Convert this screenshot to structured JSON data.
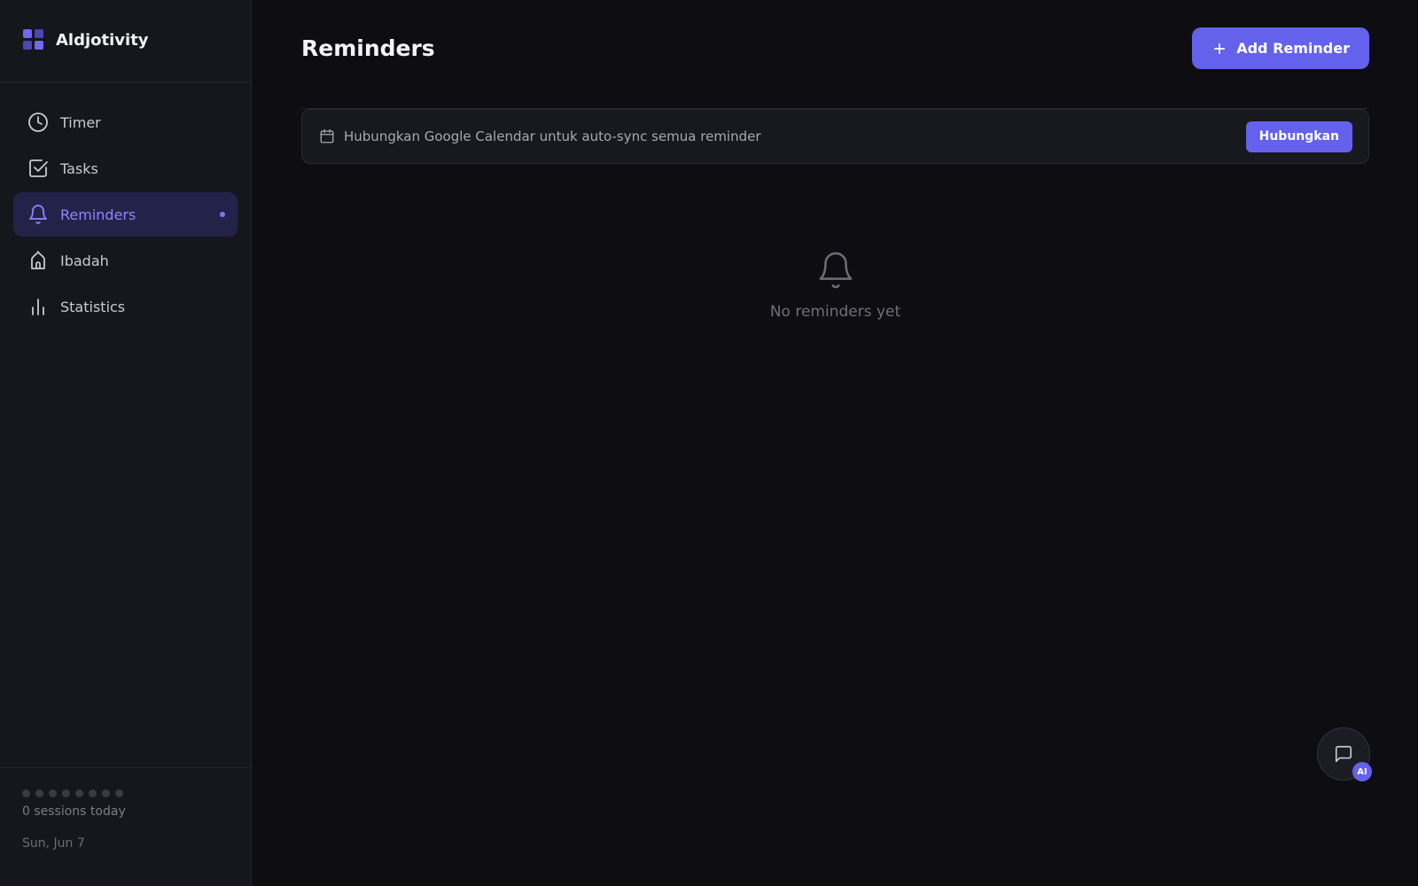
{
  "app": {
    "name": "Aldjotivity"
  },
  "sidebar": {
    "items": [
      {
        "label": "Timer",
        "icon": "clock-icon"
      },
      {
        "label": "Tasks",
        "icon": "checkbox-icon"
      },
      {
        "label": "Reminders",
        "icon": "bell-icon",
        "active": true
      },
      {
        "label": "Ibadah",
        "icon": "mosque-icon"
      },
      {
        "label": "Statistics",
        "icon": "bar-chart-icon"
      }
    ],
    "footer": {
      "sessions_text": "0 sessions today",
      "date_text": "Sun, Jun 7",
      "session_dot_count": 8
    }
  },
  "main": {
    "title": "Reminders",
    "add_button_label": "Add Reminder",
    "banner": {
      "text": "Hubungkan Google Calendar untuk auto-sync semua reminder",
      "button_label": "Hubungkan"
    },
    "empty_state": {
      "text": "No reminders yet"
    }
  },
  "ai_fab": {
    "badge": "AI"
  },
  "colors": {
    "accent": "#6461ec",
    "active_text": "#8a86ff",
    "background": "#0e0e12",
    "sidebar_bg": "#16161d"
  }
}
